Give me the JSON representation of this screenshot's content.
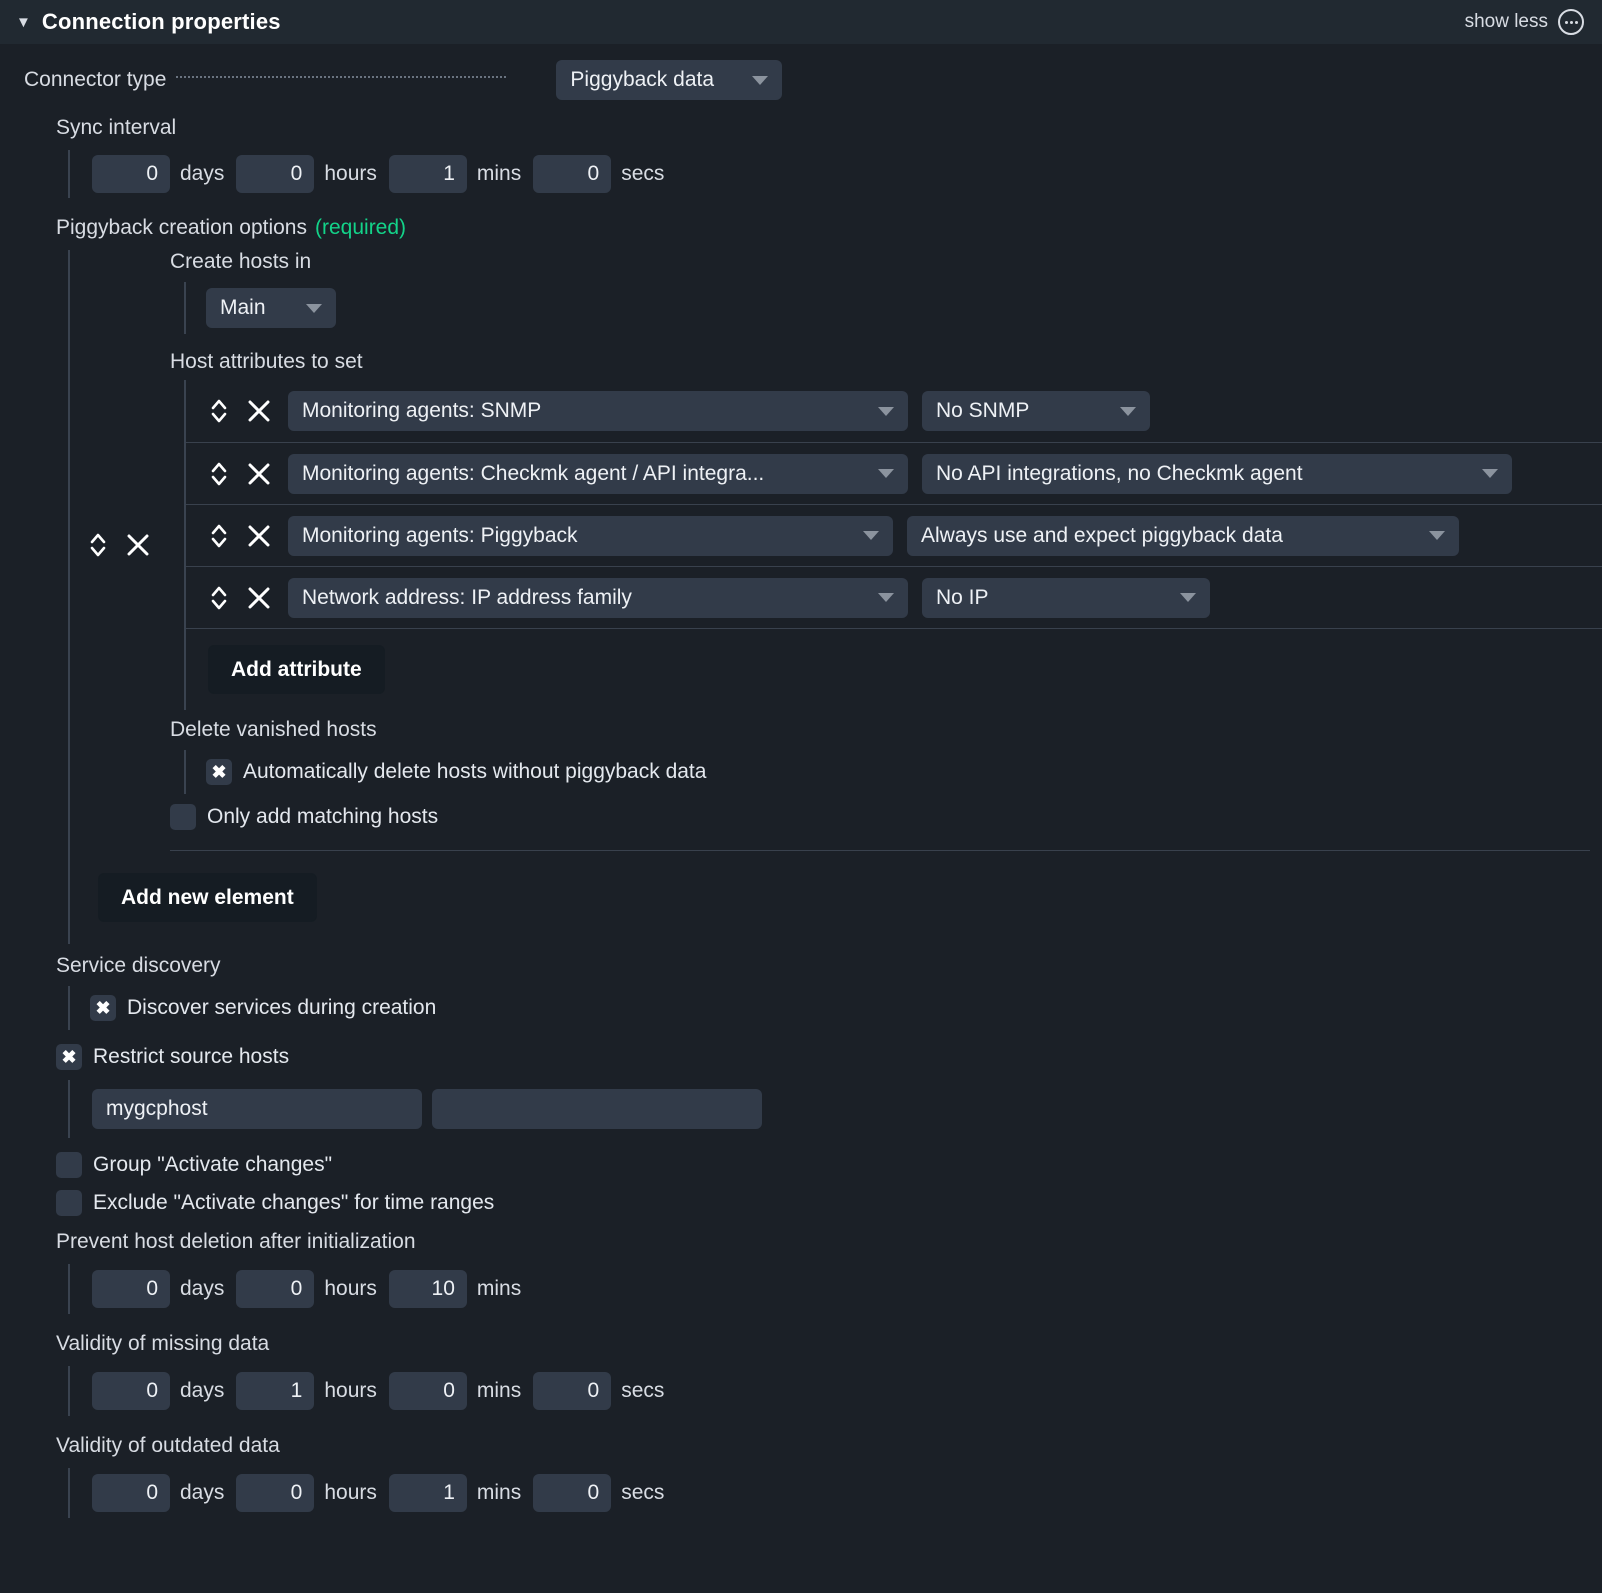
{
  "header": {
    "title": "Connection properties",
    "caret": "▼",
    "show_less": "show less",
    "menu_icon": "ellipsis-icon"
  },
  "connector_type": {
    "label": "Connector type",
    "value": "Piggyback data"
  },
  "sync_interval": {
    "label": "Sync interval",
    "days": "0",
    "days_unit": "days",
    "hours": "0",
    "hours_unit": "hours",
    "mins": "1",
    "mins_unit": "mins",
    "secs": "0",
    "secs_unit": "secs"
  },
  "piggyback_creation": {
    "label": "Piggyback creation options",
    "required": "(required)",
    "create_hosts_in": {
      "label": "Create hosts in",
      "value": "Main"
    },
    "host_attributes": {
      "label": "Host attributes to set",
      "rows": [
        {
          "key": "Monitoring agents: SNMP",
          "value": "No SNMP",
          "key_width": 620,
          "value_width": 228
        },
        {
          "key": "Monitoring agents: Checkmk agent / API integra...",
          "value": "No API integrations, no Checkmk agent",
          "key_width": 620,
          "value_width": 590
        },
        {
          "key": "Monitoring agents: Piggyback",
          "value": "Always use and expect piggyback data",
          "key_width": 605,
          "value_width": 552
        },
        {
          "key": "Network address: IP address family",
          "value": "No IP",
          "key_width": 620,
          "value_width": 288
        }
      ],
      "add_attribute_label": "Add attribute"
    },
    "delete_vanished_hosts": {
      "label": "Delete vanished hosts",
      "checkbox_label": "Automatically delete hosts without piggyback data",
      "checked": true,
      "check_glyph": "✖"
    },
    "only_add_matching_hosts": {
      "label": "Only add matching hosts",
      "checked": false
    },
    "add_new_element_label": "Add new element"
  },
  "service_discovery": {
    "label": "Service discovery",
    "checkbox_label": "Discover services during creation",
    "checked": true
  },
  "restrict_source_hosts": {
    "label": "Restrict source hosts",
    "checked": true,
    "entries": [
      "mygcphost",
      ""
    ]
  },
  "group_activate_changes": {
    "label": "Group \"Activate changes\"",
    "checked": false
  },
  "exclude_activate_changes": {
    "label": "Exclude \"Activate changes\" for time ranges",
    "checked": false
  },
  "prevent_host_deletion": {
    "label": "Prevent host deletion after initialization",
    "days": "0",
    "days_unit": "days",
    "hours": "0",
    "hours_unit": "hours",
    "mins": "10",
    "mins_unit": "mins"
  },
  "validity_missing_data": {
    "label": "Validity of missing data",
    "days": "0",
    "days_unit": "days",
    "hours": "1",
    "hours_unit": "hours",
    "mins": "0",
    "mins_unit": "mins",
    "secs": "0",
    "secs_unit": "secs"
  },
  "validity_outdated_data": {
    "label": "Validity of outdated data",
    "days": "0",
    "days_unit": "days",
    "hours": "0",
    "hours_unit": "hours",
    "mins": "1",
    "mins_unit": "mins",
    "secs": "0",
    "secs_unit": "secs"
  },
  "icons": {
    "sort": "sort-updown-icon",
    "remove": "remove-x-icon",
    "dropdown": "chevron-down-icon"
  }
}
